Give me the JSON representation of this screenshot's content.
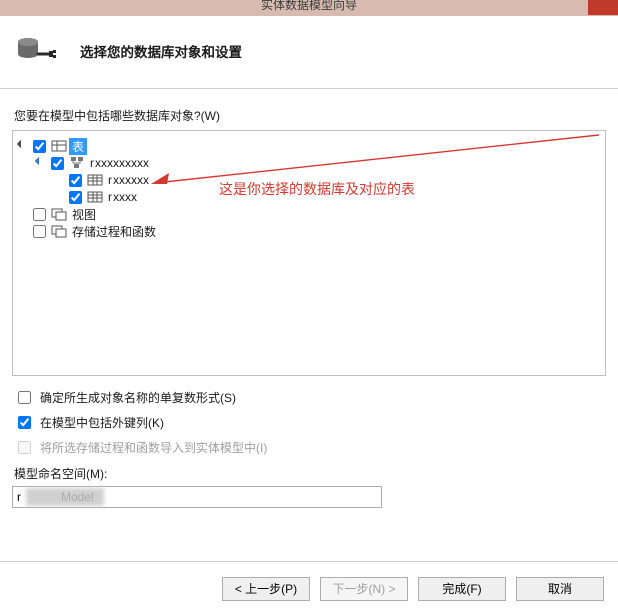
{
  "titlebar": {
    "title": "实体数据模型向导"
  },
  "header": {
    "title": "选择您的数据库对象和设置"
  },
  "prompt": "您要在模型中包括哪些数据库对象?(W)",
  "tree": {
    "root": {
      "tables": {
        "label": "表",
        "checked": true,
        "selected": true
      },
      "schema": {
        "label": "r",
        "checked": true
      },
      "table_items": [
        {
          "label": "r",
          "checked": true
        },
        {
          "label": "r",
          "checked": true
        }
      ],
      "views": {
        "label": "视图",
        "checked": false
      },
      "procs": {
        "label": "存储过程和函数",
        "checked": false
      }
    }
  },
  "annotation": "这是你选择的数据库及对应的表",
  "options": {
    "plural": {
      "label": "确定所生成对象名称的单复数形式(S)",
      "checked": false
    },
    "fk": {
      "label": "在模型中包括外键列(K)",
      "checked": true
    },
    "import": {
      "label": "将所选存储过程和函数导入到实体模型中(I)",
      "checked": false,
      "disabled": true
    }
  },
  "namespace": {
    "label": "模型命名空间(M):",
    "value": "r            Model"
  },
  "buttons": {
    "prev": "< 上一步(P)",
    "next": "下一步(N) >",
    "finish": "完成(F)",
    "cancel": "取消"
  }
}
